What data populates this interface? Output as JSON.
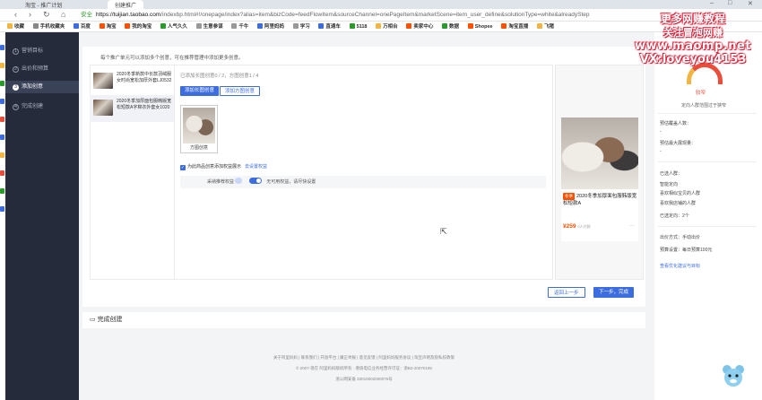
{
  "browser": {
    "tabs": [
      "淘宝 - 推广计划",
      "创建推广"
    ],
    "url_protocol_label": "安全",
    "url_host": "https://tuijian.taobao.com",
    "url_path": "/indexbp.html#!/onepage/index?alias=item&bizCode=feedFlowItem&sourceChannel=onePageItem&marketScene=item_user_define&solutionType=white&alreadyStep",
    "bookmarks": [
      "收藏",
      "手机收藏夹",
      "百度",
      "淘宝",
      "我的淘宝",
      "人气久久",
      "生意参谋",
      "千牛",
      "阿里妈妈",
      "学习",
      "直通车",
      "5118",
      "万相台",
      "卖家中心",
      "数据",
      "Shopee",
      "淘宝直播",
      "飞猪"
    ]
  },
  "sidebar": {
    "items": [
      {
        "num": "1",
        "label": "营销目标"
      },
      {
        "num": "2",
        "label": "出价和预算"
      },
      {
        "num": "3",
        "label": "添加创意"
      },
      {
        "num": "4",
        "label": "完成创建"
      }
    ]
  },
  "main": {
    "tip": "每个推广单元可以添加多个创意，可在推荐管理中添加更多创意。",
    "items": [
      {
        "text": "2020冬季新款中长款羽绒服女时尚宽松加厚外套LJ0532"
      },
      {
        "text": "2020冬季加厚面包服韩版宽松短款A字棉衣外套女1020"
      }
    ],
    "counts": "已添加长图创意0 / 2，方图创意1 / 4",
    "add_long_btn": "添加长图创意",
    "add_square_btn": "添加方图创意",
    "creative_label": "方图创意",
    "benefit_text": "为此商品创意添加权益展示",
    "benefit_link": "去设置权益",
    "option_label": "采纳推荐权益",
    "option_desc": "无可用权益，请尽快设置",
    "prev_btn": "返回上一步",
    "next_btn": "下一步，完成",
    "done_label": "完成创建"
  },
  "preview": {
    "tag": "冬季",
    "title": "2020冬季加厚面包服韩版宽松短款A",
    "price": "¥259",
    "sales": "0人付款",
    "more": "···"
  },
  "right": {
    "gauge_label": "较窄",
    "gauge_desc": "定向人群范围过于狭窄",
    "est_reach_label": "预估覆盖人数：",
    "est_reach_val": "-",
    "est_max_label": "预估最大展现量：",
    "est_max_val": "-",
    "selected_label": "已选人群：",
    "selected_items": [
      "智能定向",
      "喜欢相似宝贝的人群",
      "喜欢我店铺的人群",
      "已选定向：2个"
    ],
    "bid_method": "出价方式：手动出价",
    "budget": "预算设置：每日预算100元",
    "link": "查看优化建议与目标"
  },
  "footer": {
    "line1": "关于阿里妈妈 | 联系我们 | 开放平台 | 廉正举报 | 意见反馈 | 阿里妈妈服务协议 | 淘宝声明及隐私权政策",
    "line2": "© 2007-现在 阿里妈妈版权所有 · 增值电信业务经营许可证：浙B2-20070195",
    "line3": "浙公网安备 33010002000075号"
  },
  "watermark": {
    "line1": "更多网赚教程",
    "line2": "关注冒泡网赚",
    "line3": "www.maomp.net",
    "line4": "VX:loveyou4153"
  },
  "colors": {
    "primary": "#3d6cde",
    "sidebar_bg": "#252b3a",
    "price": "#ff5000",
    "gauge": "#e94e3b"
  }
}
